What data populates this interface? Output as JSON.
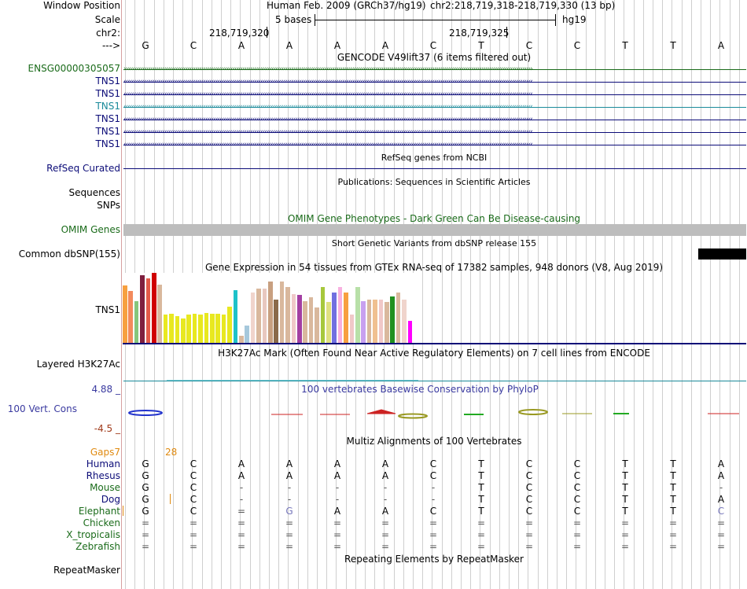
{
  "browser": {
    "header": {
      "window_position_label": "Window Position",
      "assembly": "Human Feb. 2009 (GRCh37/hg19)",
      "position": "chr2:218,719,318-218,719,330 (13 bp)",
      "scale_label": "Scale",
      "scale_text": "5 bases",
      "scale_db": "hg19",
      "chrom_label": "chr2:",
      "coord_1": "218,719,320",
      "coord_2": "218,719,325",
      "strand_label": "--->"
    },
    "reference_bases": [
      "G",
      "C",
      "A",
      "A",
      "A",
      "A",
      "C",
      "T",
      "C",
      "C",
      "T",
      "T",
      "A"
    ],
    "gencode": {
      "title": "GENCODE V49lift37 (6 items filtered out)",
      "tracks": [
        {
          "name": "ENSG00000305057",
          "color": "#1a6b1a",
          "direction": ">"
        },
        {
          "name": "TNS1",
          "color": "#0c0c78",
          "direction": "<"
        },
        {
          "name": "TNS1",
          "color": "#0c0c78",
          "direction": "<"
        },
        {
          "name": "TNS1",
          "color": "#1a8a9a",
          "direction": "<"
        },
        {
          "name": "TNS1",
          "color": "#0c0c78",
          "direction": "<"
        },
        {
          "name": "TNS1",
          "color": "#0c0c78",
          "direction": "<"
        },
        {
          "name": "TNS1",
          "color": "#0c0c78",
          "direction": "<"
        }
      ]
    },
    "refseq": {
      "label": "RefSeq Curated",
      "title": "RefSeq genes from NCBI",
      "color": "#0c0c78"
    },
    "publications": {
      "title": "Publications: Sequences in Scientific Articles",
      "label_sequences": "Sequences",
      "label_snps": "SNPs"
    },
    "omim": {
      "title": "OMIM Gene Phenotypes - Dark Green Can Be Disease-causing",
      "label": "OMIM Genes",
      "color": "#1a6b1a"
    },
    "dbsnp": {
      "title": "Short Genetic Variants from dbSNP release 155",
      "label": "Common dbSNP(155)"
    },
    "gtex": {
      "title": "Gene Expression in 54 tissues from GTEx RNA-seq of 17382 samples, 948 donors (V8, Aug 2019)",
      "label": "TNS1",
      "bars": [
        {
          "level": 0.82,
          "color": "#f7a040"
        },
        {
          "level": 0.74,
          "color": "#f38a5c"
        },
        {
          "level": 0.6,
          "color": "#86c67c"
        },
        {
          "level": 0.97,
          "color": "#7e1f3f"
        },
        {
          "level": 0.92,
          "color": "#e25a4a"
        },
        {
          "level": 1.0,
          "color": "#d00000"
        },
        {
          "level": 0.83,
          "color": "#d9b89d"
        },
        {
          "level": 0.4,
          "color": "#e8e820"
        },
        {
          "level": 0.42,
          "color": "#e8e820"
        },
        {
          "level": 0.38,
          "color": "#e8e820"
        },
        {
          "level": 0.35,
          "color": "#e8e820"
        },
        {
          "level": 0.4,
          "color": "#e8e820"
        },
        {
          "level": 0.42,
          "color": "#e8e820"
        },
        {
          "level": 0.4,
          "color": "#e8e820"
        },
        {
          "level": 0.43,
          "color": "#e8e820"
        },
        {
          "level": 0.42,
          "color": "#e8e820"
        },
        {
          "level": 0.42,
          "color": "#e8e820"
        },
        {
          "level": 0.4,
          "color": "#e8e820"
        },
        {
          "level": 0.52,
          "color": "#e8e820"
        },
        {
          "level": 0.75,
          "color": "#1dc2c9"
        },
        {
          "level": 0.1,
          "color": "#d9b89d"
        },
        {
          "level": 0.25,
          "color": "#a6c8dc"
        },
        {
          "level": 0.72,
          "color": "#f0d4cc"
        },
        {
          "level": 0.78,
          "color": "#d9b89d"
        },
        {
          "level": 0.78,
          "color": "#e8c8c0"
        },
        {
          "level": 0.88,
          "color": "#c8a080"
        },
        {
          "level": 0.62,
          "color": "#8a6a4a"
        },
        {
          "level": 0.88,
          "color": "#d9b89d"
        },
        {
          "level": 0.8,
          "color": "#d9b89d"
        },
        {
          "level": 0.7,
          "color": "#f0c8c8"
        },
        {
          "level": 0.68,
          "color": "#a33fa3"
        },
        {
          "level": 0.6,
          "color": "#d9b89d"
        },
        {
          "level": 0.65,
          "color": "#d9b89d"
        },
        {
          "level": 0.5,
          "color": "#d9b89d"
        },
        {
          "level": 0.8,
          "color": "#a7c83c"
        },
        {
          "level": 0.58,
          "color": "#e0e080"
        },
        {
          "level": 0.72,
          "color": "#7070e0"
        },
        {
          "level": 0.8,
          "color": "#f8b0e0"
        },
        {
          "level": 0.72,
          "color": "#f7a040"
        },
        {
          "level": 0.4,
          "color": "#f0c8c8"
        },
        {
          "level": 0.8,
          "color": "#b8e0a8"
        },
        {
          "level": 0.6,
          "color": "#c8a0f0"
        },
        {
          "level": 0.62,
          "color": "#d9b89d"
        },
        {
          "level": 0.62,
          "color": "#f0c090"
        },
        {
          "level": 0.62,
          "color": "#f0c8c8"
        },
        {
          "level": 0.58,
          "color": "#d9b89d"
        },
        {
          "level": 0.66,
          "color": "#209020"
        },
        {
          "level": 0.72,
          "color": "#d9b89d"
        },
        {
          "level": 0.62,
          "color": "#f0d4cc"
        },
        {
          "level": 0.32,
          "color": "#ff00ff"
        }
      ]
    },
    "h3k27ac": {
      "title": "H3K27Ac Mark (Often Found Near Active Regulatory Elements) on 7 cell lines from ENCODE",
      "label": "Layered H3K27Ac",
      "color": "#1a8a9a"
    },
    "phylop": {
      "title": "100 vertebrates Basewise Conservation by PhyloP",
      "label": "100 Vert. Cons",
      "max": "4.88 _",
      "min": "-4.5 _",
      "title_color": "#3a3aa0",
      "max_color": "#3a3aa0",
      "min_color": "#a03a1a"
    },
    "multiz": {
      "title": "Multiz Alignments of 100 Vertebrates",
      "gaps_label": "Gaps",
      "gap_count_1": "7",
      "gap_count_2": "28",
      "gap_color": "#e08a10",
      "species": [
        {
          "name": "Human",
          "color": "#0c0c78",
          "bases": [
            "G",
            "C",
            "A",
            "A",
            "A",
            "A",
            "C",
            "T",
            "C",
            "C",
            "T",
            "T",
            "A"
          ]
        },
        {
          "name": "Rhesus",
          "color": "#0c0c78",
          "bases": [
            "G",
            "C",
            "A",
            "A",
            "A",
            "A",
            "C",
            "T",
            "C",
            "C",
            "T",
            "T",
            "A"
          ]
        },
        {
          "name": "Mouse",
          "color": "#1a6b1a",
          "bases": [
            "G",
            "C",
            "-",
            "-",
            "-",
            "-",
            "-",
            "T",
            "C",
            "C",
            "T",
            "T",
            "-"
          ]
        },
        {
          "name": "Dog",
          "color": "#0c0c78",
          "bases": [
            "G",
            "C",
            "-",
            "-",
            "-",
            "-",
            "-",
            "T",
            "C",
            "C",
            "T",
            "T",
            "A"
          ]
        },
        {
          "name": "Elephant",
          "color": "#1a6b1a",
          "bases": [
            "G",
            "C",
            "=",
            "G",
            "A",
            "A",
            "C",
            "T",
            "C",
            "C",
            "T",
            "T",
            "C"
          ]
        },
        {
          "name": "Chicken",
          "color": "#1a6b1a",
          "bases": [
            "=",
            "=",
            "=",
            "=",
            "=",
            "=",
            "=",
            "=",
            "=",
            "=",
            "=",
            "=",
            "="
          ]
        },
        {
          "name": "X_tropicalis",
          "color": "#1a6b1a",
          "bases": [
            "=",
            "=",
            "=",
            "=",
            "=",
            "=",
            "=",
            "=",
            "=",
            "=",
            "=",
            "=",
            "="
          ]
        },
        {
          "name": "Zebrafish",
          "color": "#1a6b1a",
          "bases": [
            "=",
            "=",
            "=",
            "=",
            "=",
            "=",
            "=",
            "=",
            "=",
            "=",
            "=",
            "=",
            "="
          ]
        }
      ]
    },
    "repeatmasker": {
      "title": "Repeating Elements by RepeatMasker",
      "label": "RepeatMasker"
    }
  }
}
